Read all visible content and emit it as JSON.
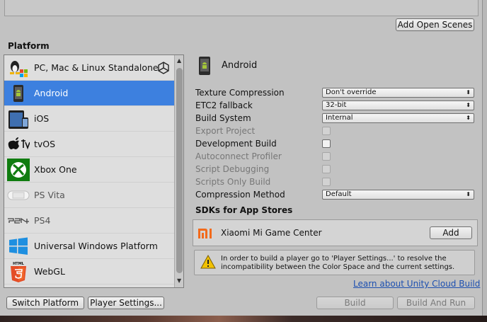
{
  "header": {
    "add_open_scenes_label": "Add Open Scenes"
  },
  "platform_section": {
    "title": "Platform",
    "items": [
      {
        "label": "PC, Mac & Linux Standalone",
        "icon": "standalone-icon",
        "selected": false,
        "current": true
      },
      {
        "label": "Android",
        "icon": "android-icon",
        "selected": true,
        "current": false
      },
      {
        "label": "iOS",
        "icon": "ios-icon",
        "selected": false,
        "current": false
      },
      {
        "label": "tvOS",
        "icon": "tvos-icon",
        "selected": false,
        "current": false
      },
      {
        "label": "Xbox One",
        "icon": "xbox-icon",
        "selected": false,
        "current": false
      },
      {
        "label": "PS Vita",
        "icon": "psvita-icon",
        "selected": false,
        "current": false
      },
      {
        "label": "PS4",
        "icon": "ps4-icon",
        "selected": false,
        "current": false
      },
      {
        "label": "Universal Windows Platform",
        "icon": "windows-icon",
        "selected": false,
        "current": false
      },
      {
        "label": "WebGL",
        "icon": "html5-icon",
        "selected": false,
        "current": false
      }
    ]
  },
  "settings": {
    "platform_title": "Android",
    "texture_compression": {
      "label": "Texture Compression",
      "value": "Don't override"
    },
    "etc2_fallback": {
      "label": "ETC2 fallback",
      "value": "32-bit"
    },
    "build_system": {
      "label": "Build System",
      "value": "Internal"
    },
    "export_project": {
      "label": "Export Project"
    },
    "development_build": {
      "label": "Development Build"
    },
    "autoconnect_profiler": {
      "label": "Autoconnect Profiler"
    },
    "script_debugging": {
      "label": "Script Debugging"
    },
    "scripts_only_build": {
      "label": "Scripts Only Build"
    },
    "compression_method": {
      "label": "Compression Method",
      "value": "Default"
    }
  },
  "sdk_section": {
    "title": "SDKs for App Stores",
    "store_name": "Xiaomi Mi Game Center",
    "add_label": "Add"
  },
  "help_message": {
    "line1": "In order to build a player go to 'Player Settings...' to resolve the",
    "line2": "incompatibility between the Color Space and the current settings."
  },
  "cloud_build_link": "Learn about Unity Cloud Build",
  "footer": {
    "switch_platform_label": "Switch Platform",
    "player_settings_label": "Player Settings...",
    "build_label": "Build",
    "build_and_run_label": "Build And Run"
  },
  "colors": {
    "selection": "#3d80df",
    "window_bg": "#c2c2c2",
    "link": "#1c4fb0",
    "xiaomi_orange": "#f26a1b",
    "warning_yellow": "#f2c200"
  }
}
